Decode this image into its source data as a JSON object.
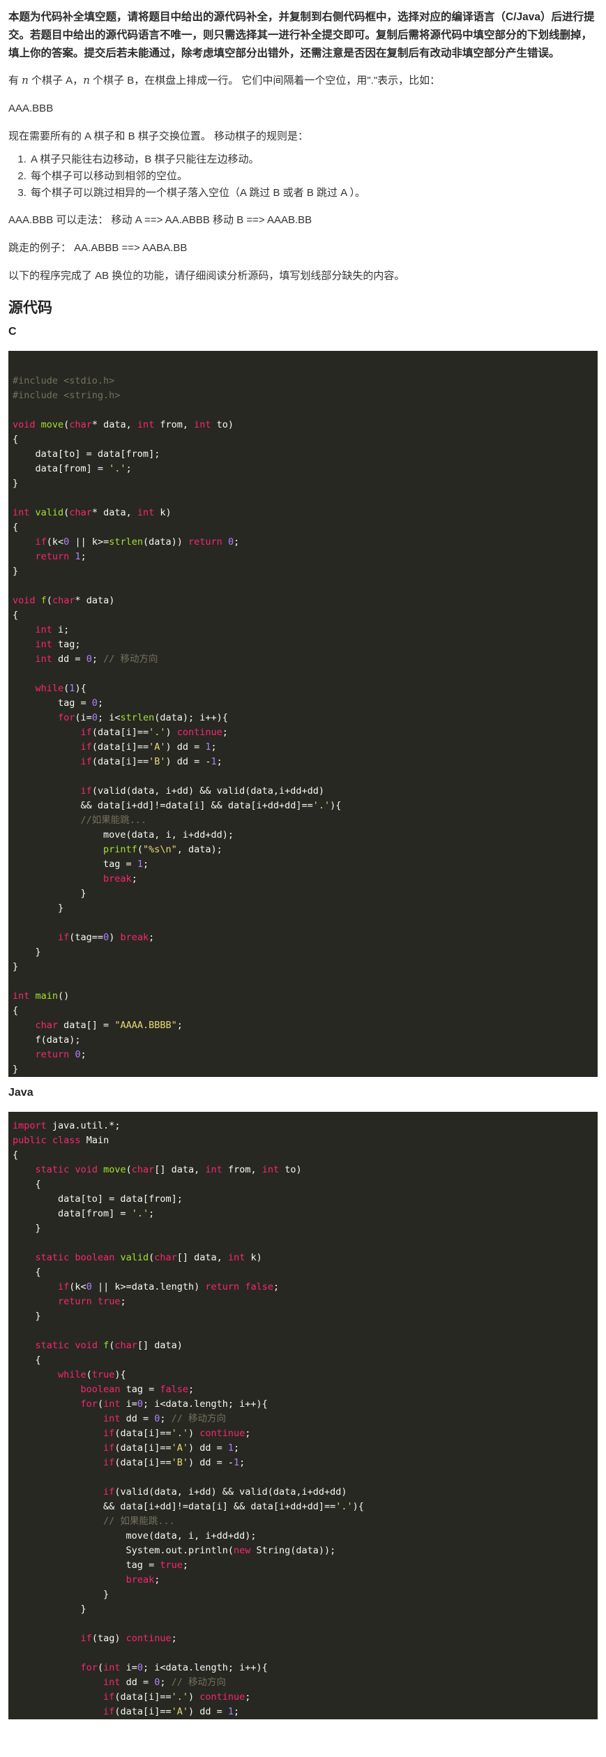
{
  "intro": "本题为代码补全填空题，请将题目中给出的源代码补全，并复制到右侧代码框中，选择对应的编译语言（C/Java）后进行提交。若题目中给出的源代码语言不唯一，则只需选择其一进行补全提交即可。复制后需将源代码中填空部分的下划线删掉，填上你的答案。提交后若未能通过，除考虑填空部分出错外，还需注意是否因在复制后有改动非填空部分产生错误。",
  "p1": {
    "a": "有 ",
    "n1": "n",
    "b": " 个棋子 A，",
    "n2": "n",
    "c": " 个棋子 B，在棋盘上排成一行。 它们中间隔着一个空位，用\".\"表示，比如："
  },
  "p2": "AAA.BBB",
  "p3": "现在需要所有的 A 棋子和 B 棋子交换位置。 移动棋子的规则是：",
  "rules": [
    "A 棋子只能往右边移动，B 棋子只能往左边移动。",
    "每个棋子可以移动到相邻的空位。",
    "每个棋子可以跳过相异的一个棋子落入空位（A 跳过 B 或者 B 跳过 A ）。"
  ],
  "p4": "AAA.BBB 可以走法： 移动 A ==> AA.ABBB 移动 B ==> AAAB.BB",
  "p5": "跳走的例子： AA.ABBB ==> AABA.BB",
  "p6": "以下的程序完成了 AB 换位的功能，请仔细阅读分析源码，填写划线部分缺失的内容。",
  "section_title": "源代码",
  "lang_c": "C",
  "lang_java": "Java",
  "comments": {
    "move_dir": "// 移动方向",
    "move_dir_java2": "// 移动方向",
    "if_can_jump": "//如果能跳...",
    "if_can_jump_java": "// 如果能跳..."
  },
  "strings": {
    "fmt": "\"%s\\n\"",
    "init": "\"AAAA.BBBB\"",
    "dot": "'.'",
    "a": "'A'",
    "b": "'B'"
  },
  "colors": {
    "code_bg": "#272822",
    "keyword": "#f92672",
    "function": "#a6e22e",
    "number": "#ae81ff",
    "string": "#e6db74",
    "comment": "#75715e"
  }
}
